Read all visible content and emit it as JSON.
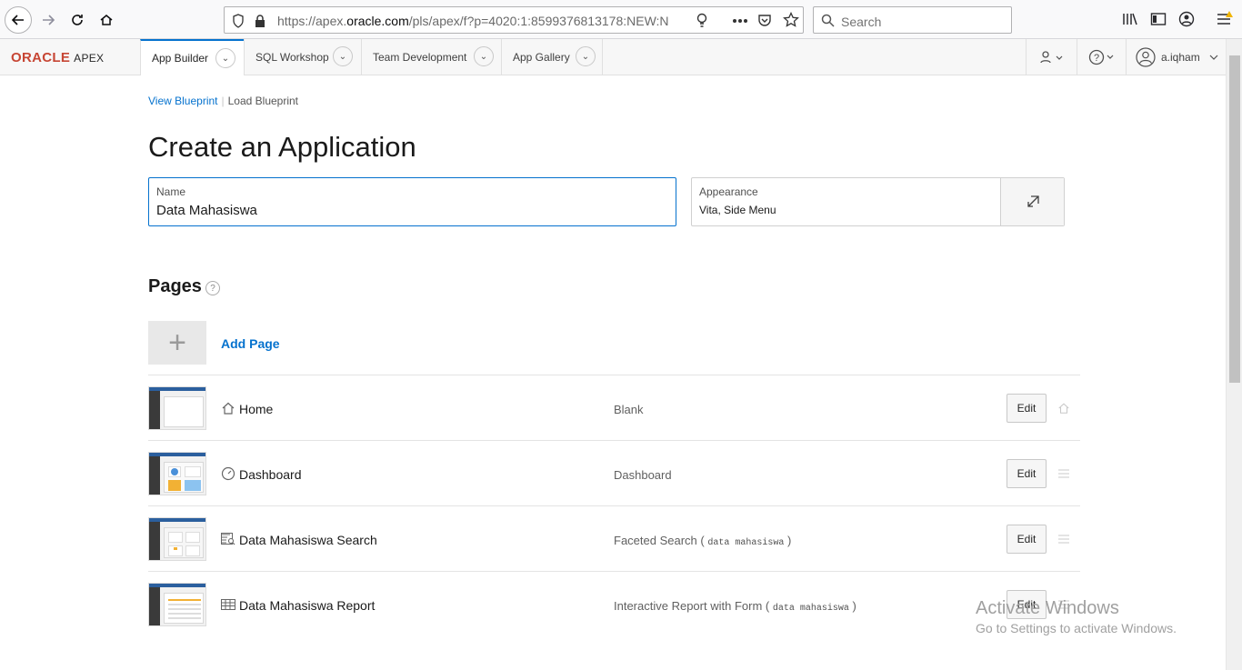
{
  "browser": {
    "url_prefix": "https://apex.",
    "url_domain": "oracle.com",
    "url_rest": "/pls/apex/f?p=4020:1:8599376813178:NEW:N",
    "search_placeholder": "Search"
  },
  "apex_header": {
    "logo_oracle": "ORACLE",
    "logo_apex": "APEX",
    "tabs": [
      {
        "label": "App Builder"
      },
      {
        "label": "SQL Workshop"
      },
      {
        "label": "Team Development"
      },
      {
        "label": "App Gallery"
      }
    ],
    "user": "a.iqham"
  },
  "breadcrumbs": {
    "view_blueprint": "View Blueprint",
    "load_blueprint": "Load Blueprint"
  },
  "page_title": "Create an Application",
  "name_field": {
    "label": "Name",
    "value": "Data Mahasiswa"
  },
  "appearance": {
    "label": "Appearance",
    "value": "Vita, Side Menu"
  },
  "pages_section": {
    "title": "Pages",
    "help": "?",
    "add_page_label": "Add Page",
    "add_page_symbol": "+",
    "rows": [
      {
        "name": "Home",
        "type": "Blank",
        "source": "",
        "edit": "Edit",
        "icon": "home-icon"
      },
      {
        "name": "Dashboard",
        "type": "Dashboard",
        "source": "",
        "edit": "Edit",
        "icon": "dashboard-icon"
      },
      {
        "name": "Data Mahasiswa Search",
        "type": "Faceted Search (",
        "source": "data mahasiswa",
        "source_close": ")",
        "edit": "Edit",
        "icon": "faceted-search-icon"
      },
      {
        "name": "Data Mahasiswa Report",
        "type": "Interactive Report with Form (",
        "source": "data mahasiswa",
        "source_close": ")",
        "edit": "Edit",
        "icon": "report-icon"
      }
    ]
  },
  "watermark": {
    "title": "Activate Windows",
    "subtitle": "Go to Settings to activate Windows."
  }
}
